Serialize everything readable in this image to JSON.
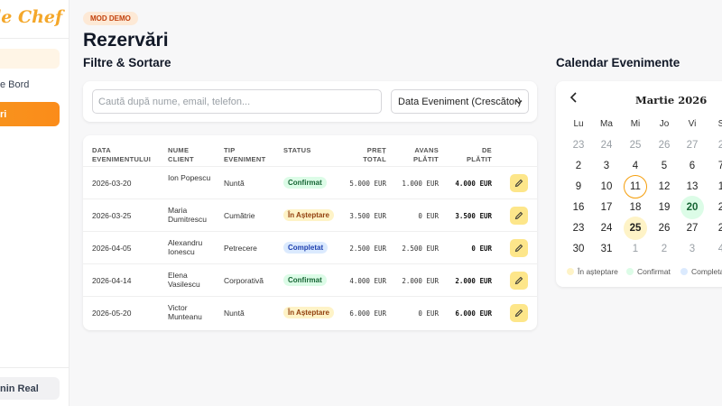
{
  "sidebar": {
    "logo": "de Chef",
    "items": [
      {
        "label": ""
      },
      {
        "label": "e Bord"
      },
      {
        "label": "ri"
      }
    ],
    "bottom": "nin Real"
  },
  "header": {
    "badge": "MOD DEMO",
    "title": "Rezervări"
  },
  "filters": {
    "title": "Filtre & Sortare",
    "search_placeholder": "Caută după nume, email, telefon...",
    "sort_value": "Data Eveniment (Crescător)"
  },
  "table": {
    "headers": [
      "DATA EVENIMENTULUI",
      "NUME CLIENT",
      "TIP EVENIMENT",
      "STATUS",
      "PREȚ TOTAL",
      "AVANS PLĂTIT",
      "DE PLĂTIT"
    ],
    "rows": [
      {
        "date": "2026-03-20",
        "client": "Ion Popescu",
        "type": "Nuntă",
        "status": "Confirmat",
        "status_kind": "confirmed",
        "total": "5.000 EUR",
        "advance": "1.000 EUR",
        "due": "4.000 EUR"
      },
      {
        "date": "2026-03-25",
        "client": "Maria Dumitrescu",
        "type": "Cumătrie",
        "status": "În Așteptare",
        "status_kind": "pending",
        "total": "3.500 EUR",
        "advance": "0 EUR",
        "due": "3.500 EUR"
      },
      {
        "date": "2026-04-05",
        "client": "Alexandru Ionescu",
        "type": "Petrecere",
        "status": "Completat",
        "status_kind": "completed",
        "total": "2.500 EUR",
        "advance": "2.500 EUR",
        "due": "0 EUR"
      },
      {
        "date": "2026-04-14",
        "client": "Elena Vasilescu",
        "type": "Corporativă",
        "status": "Confirmat",
        "status_kind": "confirmed",
        "total": "4.000 EUR",
        "advance": "2.000 EUR",
        "due": "2.000 EUR"
      },
      {
        "date": "2026-05-20",
        "client": "Victor Munteanu",
        "type": "Nuntă",
        "status": "În Așteptare",
        "status_kind": "pending",
        "total": "6.000 EUR",
        "advance": "0 EUR",
        "due": "6.000 EUR"
      }
    ]
  },
  "calendar": {
    "title": "Calendar Evenimente",
    "month": "Martie 2026",
    "weekdays": [
      "Lu",
      "Ma",
      "Mi",
      "Jo",
      "Vi",
      "S"
    ],
    "weeks": [
      [
        {
          "d": "23",
          "k": "muted"
        },
        {
          "d": "24",
          "k": "muted"
        },
        {
          "d": "25",
          "k": "muted"
        },
        {
          "d": "26",
          "k": "muted"
        },
        {
          "d": "27",
          "k": "muted"
        },
        {
          "d": "2",
          "k": "muted"
        }
      ],
      [
        {
          "d": "2",
          "k": ""
        },
        {
          "d": "3",
          "k": ""
        },
        {
          "d": "4",
          "k": ""
        },
        {
          "d": "5",
          "k": ""
        },
        {
          "d": "6",
          "k": ""
        },
        {
          "d": "7",
          "k": ""
        }
      ],
      [
        {
          "d": "9",
          "k": ""
        },
        {
          "d": "10",
          "k": ""
        },
        {
          "d": "11",
          "k": "today"
        },
        {
          "d": "12",
          "k": ""
        },
        {
          "d": "13",
          "k": ""
        },
        {
          "d": "1",
          "k": ""
        }
      ],
      [
        {
          "d": "16",
          "k": ""
        },
        {
          "d": "17",
          "k": ""
        },
        {
          "d": "18",
          "k": ""
        },
        {
          "d": "19",
          "k": ""
        },
        {
          "d": "20",
          "k": "conf"
        },
        {
          "d": "2",
          "k": ""
        }
      ],
      [
        {
          "d": "23",
          "k": ""
        },
        {
          "d": "24",
          "k": ""
        },
        {
          "d": "25",
          "k": "pend"
        },
        {
          "d": "26",
          "k": ""
        },
        {
          "d": "27",
          "k": ""
        },
        {
          "d": "2",
          "k": ""
        }
      ],
      [
        {
          "d": "30",
          "k": ""
        },
        {
          "d": "31",
          "k": ""
        },
        {
          "d": "1",
          "k": "muted"
        },
        {
          "d": "2",
          "k": "muted"
        },
        {
          "d": "3",
          "k": "muted"
        },
        {
          "d": "4",
          "k": "muted"
        }
      ]
    ],
    "legend": [
      {
        "label": "În așteptare",
        "color": "#fef3c7"
      },
      {
        "label": "Confirmat",
        "color": "#dcfce7"
      },
      {
        "label": "Completat",
        "color": "#dbeafe"
      }
    ]
  },
  "icons": {
    "edit": "pencil-icon",
    "prev": "chevron-left-icon",
    "sort": "chevron-down-icon"
  }
}
